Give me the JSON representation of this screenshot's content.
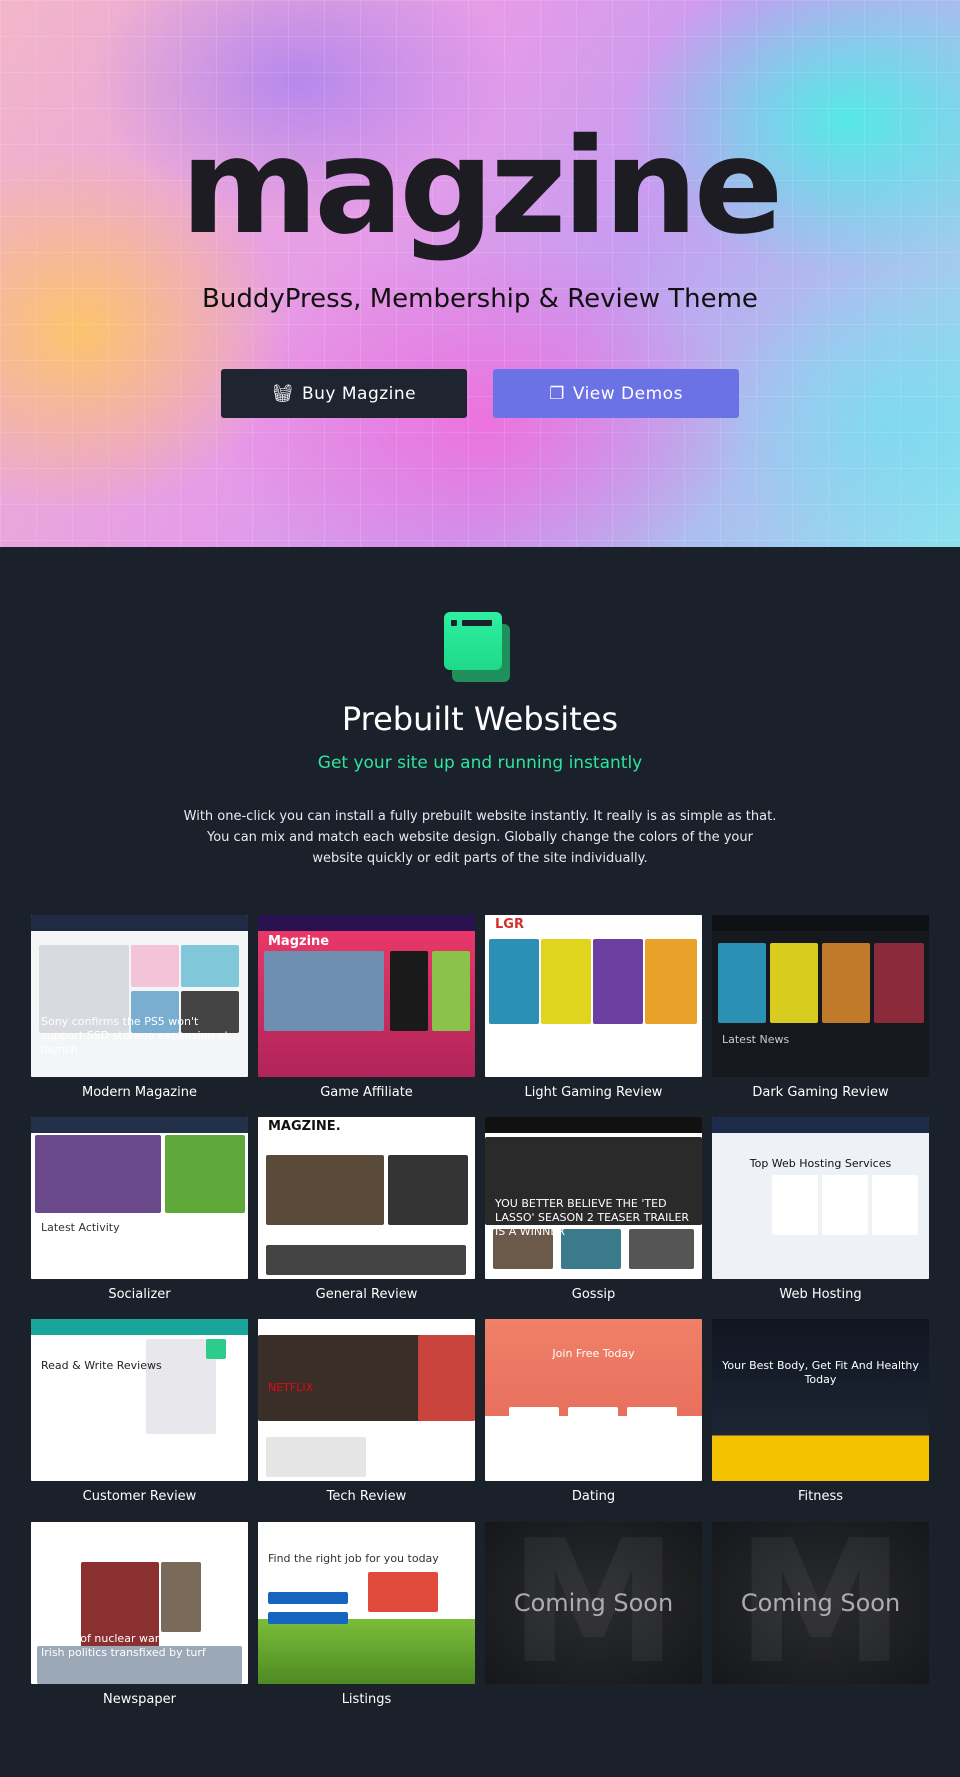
{
  "hero": {
    "logo": "magzine",
    "subtitle": "BuddyPress, Membership & Review Theme",
    "buy_label": "Buy Magzine",
    "buy_icon": "basket-icon",
    "demos_label": "View Demos",
    "demos_icon": "copy-icon"
  },
  "section": {
    "icon": "browser-windows-icon",
    "title": "Prebuilt Websites",
    "tagline": "Get your site up and running instantly",
    "description": "With one-click you can install a fully prebuilt website instantly. It really is as simple as that. You can mix and match each website design. Globally change the colors of the your website quickly or edit parts of the site individually.",
    "accent": "#2ee59d"
  },
  "demos": [
    {
      "label": "Modern Magazine",
      "headline": "Sony confirms the PS5 won't support SSD storage expansion at launch"
    },
    {
      "label": "Game Affiliate",
      "headline": "Magzine"
    },
    {
      "label": "Light Gaming Review",
      "headline": "LGR"
    },
    {
      "label": "Dark Gaming Review",
      "headline": "Latest News"
    },
    {
      "label": "Socializer",
      "headline": "Latest Activity"
    },
    {
      "label": "General Review",
      "headline": "MAGZINE."
    },
    {
      "label": "Gossip",
      "headline": "YOU BETTER BELIEVE THE 'TED LASSO' SEASON 2 TEASER TRAILER IS A WINNER"
    },
    {
      "label": "Web Hosting",
      "headline": "Top Web Hosting Services"
    },
    {
      "label": "Customer Review",
      "headline": "Read & Write Reviews"
    },
    {
      "label": "Tech Review",
      "headline": "NETFLIX"
    },
    {
      "label": "Dating",
      "headline": "Join Free Today"
    },
    {
      "label": "Fitness",
      "headline": "Your Best Body, Get Fit And Healthy Today"
    },
    {
      "label": "Newspaper",
      "headline": "Threat of nuclear war looms but Irish politics transfixed by turf"
    },
    {
      "label": "Listings",
      "headline": "Find the right job for you today"
    },
    {
      "label": "",
      "headline": "Coming Soon"
    },
    {
      "label": "",
      "headline": "Coming Soon"
    }
  ]
}
